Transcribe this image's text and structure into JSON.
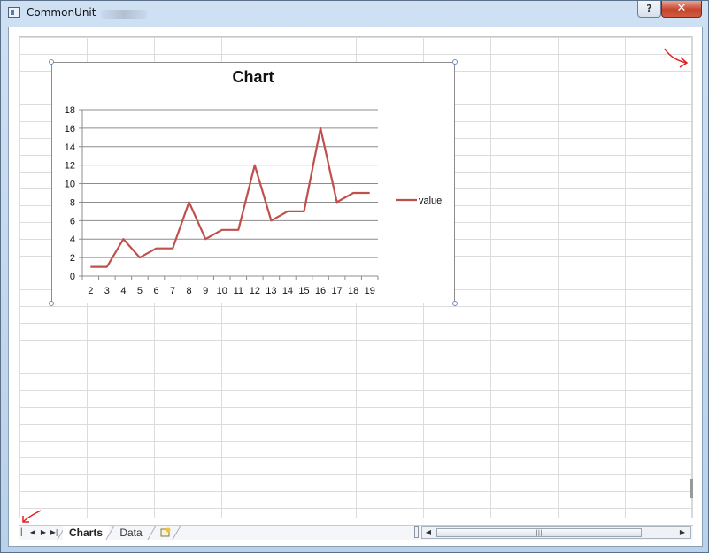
{
  "window": {
    "title": "CommonUnit",
    "help_label": "?",
    "close_label": "✕"
  },
  "chart_data": {
    "type": "line",
    "title": "Chart",
    "x": [
      2,
      3,
      4,
      5,
      6,
      7,
      8,
      9,
      10,
      11,
      12,
      13,
      14,
      15,
      16,
      17,
      18,
      19
    ],
    "series": [
      {
        "name": "value",
        "values": [
          1,
          1,
          4,
          2,
          3,
          3,
          8,
          4,
          5,
          5,
          12,
          6,
          7,
          7,
          16,
          8,
          9,
          9
        ],
        "color": "#c0504d"
      }
    ],
    "ylim": [
      0,
      18
    ],
    "yticks": [
      0,
      2,
      4,
      6,
      8,
      10,
      12,
      14,
      16,
      18
    ],
    "grid": true,
    "legend": "right"
  },
  "sheet_tabs": [
    {
      "label": "Charts",
      "active": true
    },
    {
      "label": "Data",
      "active": false
    }
  ],
  "icons": {
    "nav_prev": "◀",
    "nav_next": "▶",
    "nav_last": "▶|",
    "scroll_left": "◀",
    "scroll_right": "▶",
    "scroll_grip": "|||"
  },
  "colors": {
    "series": "#c0504d",
    "annotation": "#e02020"
  }
}
